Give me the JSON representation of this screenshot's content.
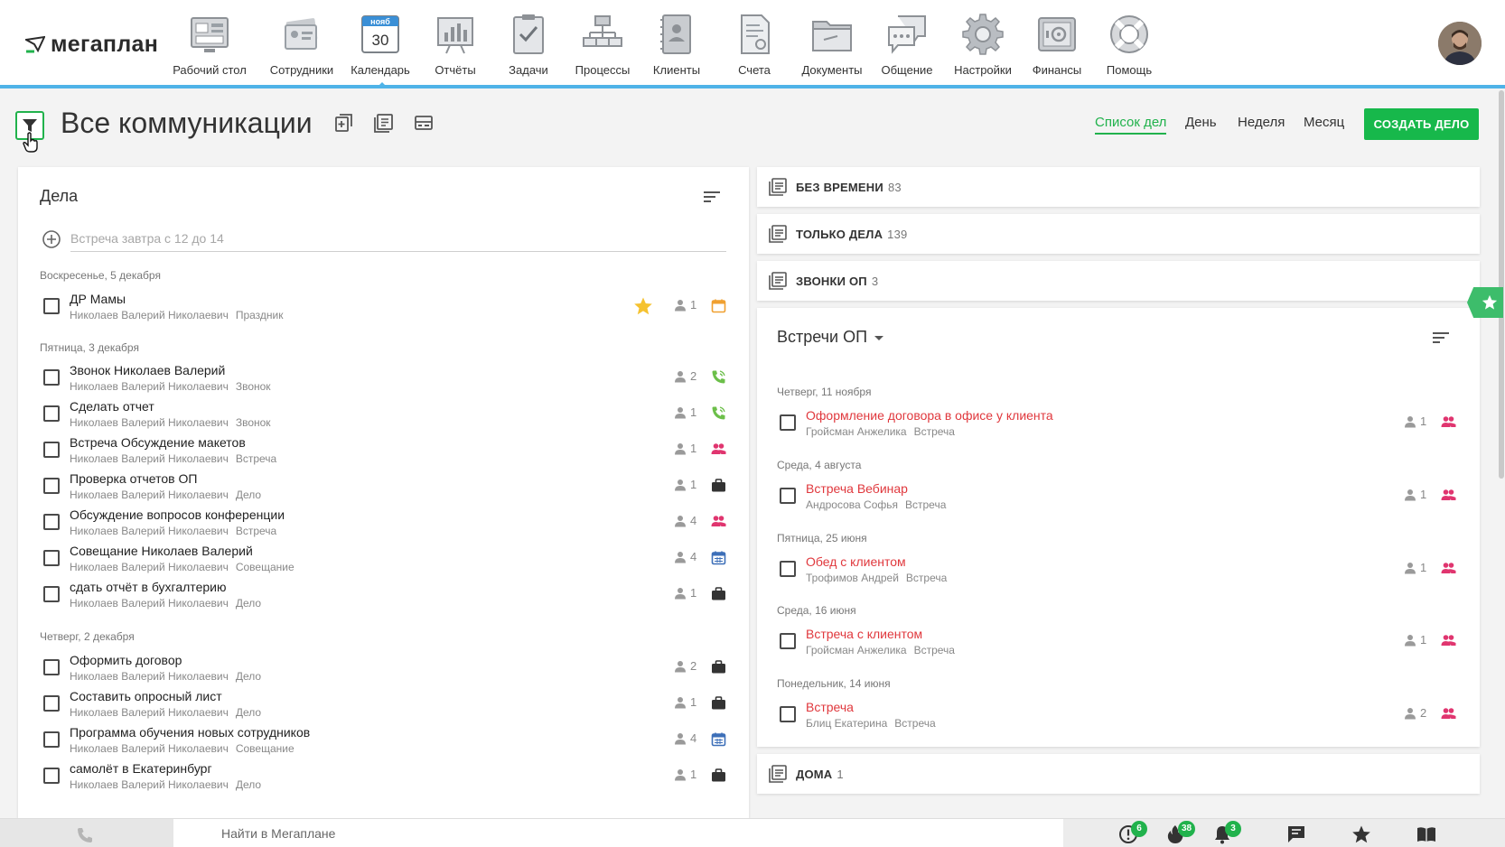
{
  "app": {
    "logo_text": "мегаплан"
  },
  "nav": [
    {
      "label": "Рабочий стол",
      "icon": "desktop-icon"
    },
    {
      "label": "Сотрудники",
      "icon": "employees-icon"
    },
    {
      "label": "Календарь",
      "icon": "calendar-icon",
      "month": "нояб",
      "day": "30",
      "active": true
    },
    {
      "label": "Отчёты",
      "icon": "reports-icon"
    },
    {
      "label": "Задачи",
      "icon": "tasks-icon"
    },
    {
      "label": "Процессы",
      "icon": "processes-icon"
    },
    {
      "label": "Клиенты",
      "icon": "clients-icon"
    },
    {
      "label": "Счета",
      "icon": "invoices-icon"
    },
    {
      "label": "Документы",
      "icon": "documents-icon"
    },
    {
      "label": "Общение",
      "icon": "chat-icon"
    },
    {
      "label": "Настройки",
      "icon": "settings-icon"
    },
    {
      "label": "Финансы",
      "icon": "finance-icon"
    },
    {
      "label": "Помощь",
      "icon": "help-icon"
    }
  ],
  "header": {
    "title": "Все коммуникации",
    "views": [
      "Список дел",
      "День",
      "Неделя",
      "Месяц"
    ],
    "active_view": "Список дел",
    "create_button": "СОЗДАТЬ ДЕЛО"
  },
  "left": {
    "heading": "Дела",
    "new_task_placeholder": "Встреча завтра с 12 до 14",
    "days": [
      {
        "label": "Воскресенье, 5 декабря",
        "tasks": [
          {
            "title": "ДР Мамы",
            "owner": "Николаев Валерий Николаевич",
            "type": "Праздник",
            "people": "1",
            "icon": "calendar-icon",
            "starred": true
          }
        ]
      },
      {
        "label": "Пятница, 3 декабря",
        "tasks": [
          {
            "title": "Звонок Николаев Валерий",
            "owner": "Николаев Валерий Николаевич",
            "type": "Звонок",
            "people": "2",
            "icon": "phone-icon"
          },
          {
            "title": "Сделать отчет",
            "owner": "Николаев Валерий Николаевич",
            "type": "Звонок",
            "people": "1",
            "icon": "phone-icon"
          },
          {
            "title": "Встреча Обсуждение макетов",
            "owner": "Николаев Валерий Николаевич",
            "type": "Встреча",
            "people": "1",
            "icon": "meeting-icon"
          },
          {
            "title": "Проверка отчетов ОП",
            "owner": "Николаев Валерий Николаевич",
            "type": "Дело",
            "people": "1",
            "icon": "briefcase-icon"
          },
          {
            "title": "Обсуждение вопросов конференции",
            "owner": "Николаев Валерий Николаевич",
            "type": "Встреча",
            "people": "4",
            "icon": "meeting-icon"
          },
          {
            "title": "Совещание Николаев Валерий",
            "owner": "Николаев Валерий Николаевич",
            "type": "Совещание",
            "people": "4",
            "icon": "conference-icon"
          },
          {
            "title": "сдать отчёт в бухгалтерию",
            "owner": "Николаев Валерий Николаевич",
            "type": "Дело",
            "people": "1",
            "icon": "briefcase-icon"
          }
        ]
      },
      {
        "label": "Четверг, 2 декабря",
        "tasks": [
          {
            "title": "Оформить договор",
            "owner": "Николаев Валерий Николаевич",
            "type": "Дело",
            "people": "2",
            "icon": "briefcase-icon"
          },
          {
            "title": "Составить опросный лист",
            "owner": "Николаев Валерий Николаевич",
            "type": "Дело",
            "people": "1",
            "icon": "briefcase-icon"
          },
          {
            "title": "Программа обучения новых сотрудников",
            "owner": "Николаев Валерий Николаевич",
            "type": "Совещание",
            "people": "4",
            "icon": "conference-icon"
          },
          {
            "title": "самолёт в Екатеринбург",
            "owner": "Николаев Валерий Николаевич",
            "type": "Дело",
            "people": "1",
            "icon": "briefcase-icon"
          }
        ]
      }
    ]
  },
  "right": {
    "groups_top": [
      {
        "name": "БЕЗ ВРЕМЕНИ",
        "count": "83"
      },
      {
        "name": "ТОЛЬКО ДЕЛА",
        "count": "139"
      },
      {
        "name": "ЗВОНКИ ОП",
        "count": "3"
      }
    ],
    "meetings": {
      "title": "Встречи ОП",
      "days": [
        {
          "label": "Четверг, 11 ноября",
          "title": "Оформление договора в офисе у клиента",
          "owner": "Гройсман Анжелика",
          "type": "Встреча",
          "people": "1"
        },
        {
          "label": "Среда, 4 августа",
          "title": "Встреча Вебинар",
          "owner": "Андросова Софья",
          "type": "Встреча",
          "people": "1"
        },
        {
          "label": "Пятница, 25 июня",
          "title": "Обед с клиентом",
          "owner": "Трофимов Андрей",
          "type": "Встреча",
          "people": "1"
        },
        {
          "label": "Среда, 16 июня",
          "title": "Встреча с клиентом",
          "owner": "Гройсман Анжелика",
          "type": "Встреча",
          "people": "1"
        },
        {
          "label": "Понедельник, 14 июня",
          "title": "Встреча",
          "owner": "Блиц Екатерина",
          "type": "Встреча",
          "people": "2"
        }
      ]
    },
    "group_bottom": {
      "name": "ДОМА",
      "count": "1"
    }
  },
  "bottom": {
    "search_placeholder": "Найти в Мегаплане",
    "badges": {
      "alerts": "6",
      "hot": "38",
      "notifications": "3"
    }
  },
  "colors": {
    "accent": "#21b24c",
    "link_red": "#e0383d",
    "topbar_line": "#4fb3e8",
    "meeting_pink": "#e0356f",
    "phone_green": "#6cbf4a",
    "calendar_orange": "#f0a030",
    "conference_blue": "#3d6fb8",
    "star_yellow": "#f5c230"
  }
}
